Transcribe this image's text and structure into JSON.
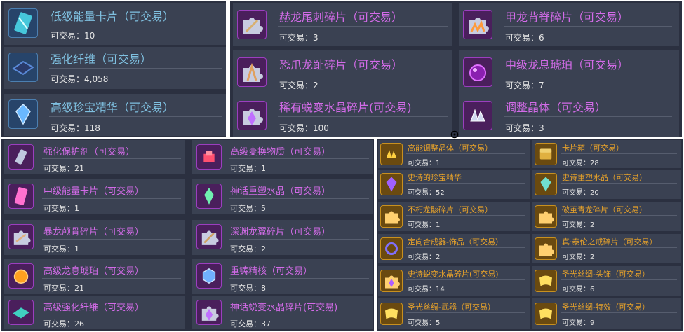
{
  "qty_label": "可交易：",
  "panel_a": [
    {
      "name": "低级能量卡片（可交易）",
      "qty": "10",
      "icon": "energy-card-icon",
      "accent": "#4ad6e8"
    },
    {
      "name": "强化纤维（可交易）",
      "qty": "4,058",
      "icon": "fiber-cloth-icon",
      "accent": "#5a8ad8"
    },
    {
      "name": "高级珍宝精华（可交易）",
      "qty": "118",
      "icon": "crystal-gem-icon",
      "accent": "#6ab8ff"
    }
  ],
  "panel_b": [
    {
      "name": "赫龙尾刺碎片（可交易）",
      "qty": "3",
      "icon": "puzzle-fragment-icon",
      "accent": "#d8b070"
    },
    {
      "name": "甲龙背脊碎片（可交易）",
      "qty": "6",
      "icon": "puzzle-fragment-icon",
      "accent": "#ff9a3a"
    },
    {
      "name": "恐爪龙趾碎片（可交易）",
      "qty": "2",
      "icon": "puzzle-fragment-icon",
      "accent": "#e0a060"
    },
    {
      "name": "中级龙息琥珀（可交易）",
      "qty": "7",
      "icon": "amber-orb-icon",
      "accent": "#c040e0"
    },
    {
      "name": "稀有蜕变水晶碎片(可交易)",
      "qty": "100",
      "icon": "puzzle-fragment-icon",
      "accent": "#c070ff"
    },
    {
      "name": "调整晶体（可交易）",
      "qty": "3",
      "icon": "crystal-cluster-icon",
      "accent": "#d0d8f0"
    }
  ],
  "panel_c": [
    {
      "name": "强化保护剂（可交易）",
      "qty": "21",
      "icon": "protect-vial-icon",
      "accent": "#c0c8e0"
    },
    {
      "name": "高级变换物质（可交易）",
      "qty": "1",
      "icon": "transform-cube-icon",
      "accent": "#ff5070"
    },
    {
      "name": "中级能量卡片（可交易）",
      "qty": "1",
      "icon": "energy-card-icon",
      "accent": "#ff70d0"
    },
    {
      "name": "神话重塑水晶（可交易）",
      "qty": "5",
      "icon": "crystal-gem-icon",
      "accent": "#70f0b0"
    },
    {
      "name": "暴龙颅骨碎片（可交易）",
      "qty": "1",
      "icon": "puzzle-fragment-icon",
      "accent": "#e0b080"
    },
    {
      "name": "深渊龙翼碎片（可交易）",
      "qty": "2",
      "icon": "puzzle-fragment-icon",
      "accent": "#d0a060"
    },
    {
      "name": "高级龙息琥珀（可交易）",
      "qty": "21",
      "icon": "amber-orb-icon",
      "accent": "#ffa020"
    },
    {
      "name": "重铸精核（可交易）",
      "qty": "8",
      "icon": "recast-core-icon",
      "accent": "#70b0ff"
    },
    {
      "name": "高级强化纤维（可交易）",
      "qty": "26",
      "icon": "fiber-cloth-icon",
      "accent": "#40d0c0"
    },
    {
      "name": "神话蜕变水晶碎片(可交易)",
      "qty": "37",
      "icon": "puzzle-fragment-icon",
      "accent": "#c070ff"
    }
  ],
  "panel_d": [
    {
      "name": "高能调整晶体（可交易）",
      "qty": "1",
      "icon": "crystal-cluster-icon",
      "accent": "#ffd040"
    },
    {
      "name": "卡片箱（可交易）",
      "qty": "28",
      "icon": "card-chest-icon",
      "accent": "#e0b040"
    },
    {
      "name": "史诗的珍宝精华",
      "qty": "52",
      "icon": "crystal-gem-icon",
      "accent": "#a060ff"
    },
    {
      "name": "史诗重塑水晶（可交易）",
      "qty": "20",
      "icon": "crystal-gem-icon",
      "accent": "#70e0d0"
    },
    {
      "name": "不朽龙骸碎片（可交易）",
      "qty": "1",
      "icon": "puzzle-fragment-icon",
      "accent": "#ffd070"
    },
    {
      "name": "破茧青龙碎片（可交易）",
      "qty": "2",
      "icon": "puzzle-fragment-icon",
      "accent": "#ffd070"
    },
    {
      "name": "定向合成器-饰品（可交易）",
      "qty": "2",
      "icon": "synth-ring-icon",
      "accent": "#8070ff"
    },
    {
      "name": "真·泰伦之戒碎片（可交易）",
      "qty": "2",
      "icon": "puzzle-fragment-icon",
      "accent": "#ffd070"
    },
    {
      "name": "史诗蜕变水晶碎片(可交易)",
      "qty": "14",
      "icon": "puzzle-fragment-icon",
      "accent": "#b060ff"
    },
    {
      "name": "圣光丝绸-头饰（可交易）",
      "qty": "6",
      "icon": "silk-cloth-icon",
      "accent": "#ffe060"
    },
    {
      "name": "圣光丝绸-武器（可交易）",
      "qty": "5",
      "icon": "silk-cloth-icon",
      "accent": "#ffe060"
    },
    {
      "name": "圣光丝绸-特效（可交易）",
      "qty": "9",
      "icon": "silk-cloth-icon",
      "accent": "#ffe060"
    }
  ]
}
